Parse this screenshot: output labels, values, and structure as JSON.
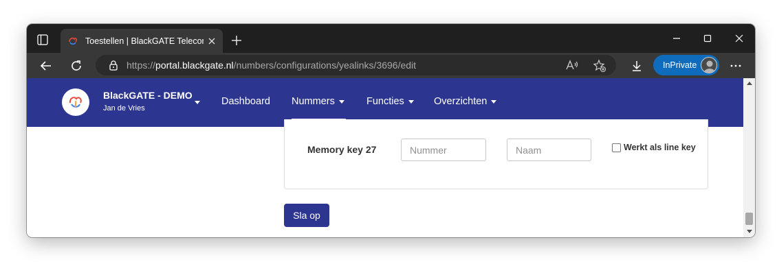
{
  "browser": {
    "tab_title": "Toestellen | BlackGATE Telecom",
    "url_scheme": "https://",
    "url_host": "portal.blackgate.nl",
    "url_path": "/numbers/configurations/yealinks/3696/edit",
    "inprivate_label": "InPrivate",
    "icons": [
      "tab-actions-icon",
      "favicon-icon",
      "close-tab-icon",
      "new-tab-icon",
      "minimize-icon",
      "maximize-icon",
      "close-window-icon",
      "back-icon",
      "refresh-icon",
      "lock-icon",
      "read-aloud-icon",
      "add-favorite-icon",
      "downloads-icon",
      "more-icon"
    ]
  },
  "navbar": {
    "brand_name": "BlackGATE - DEMO",
    "brand_user": "Jan de Vries",
    "items": [
      {
        "label": "Dashboard",
        "has_caret": false,
        "active": false
      },
      {
        "label": "Nummers",
        "has_caret": true,
        "active": true
      },
      {
        "label": "Functies",
        "has_caret": true,
        "active": false
      },
      {
        "label": "Overzichten",
        "has_caret": true,
        "active": false
      }
    ],
    "color": "#2c3590"
  },
  "form": {
    "memory_key_label": "Memory key 27",
    "number_placeholder": "Nummer",
    "name_placeholder": "Naam",
    "line_key_label": "Werkt als line key",
    "line_key_checked": false,
    "save_label": "Sla op"
  }
}
